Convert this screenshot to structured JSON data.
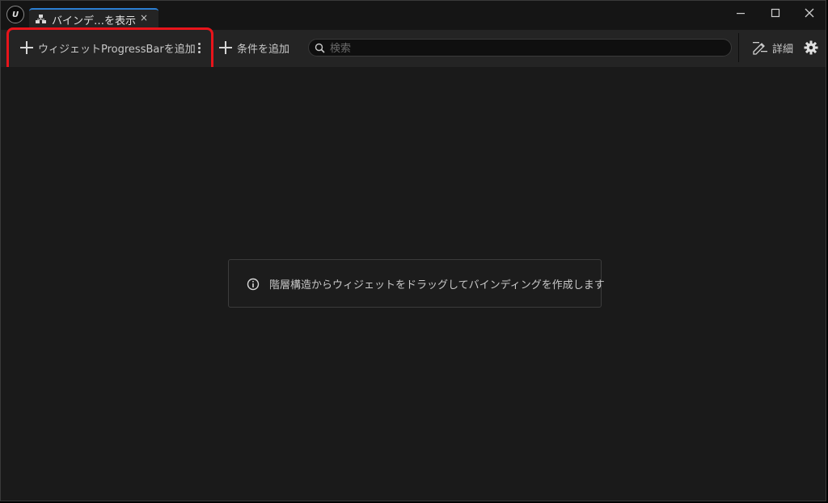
{
  "window": {
    "tab_title": "バインデ…を表示",
    "tab_close": "×"
  },
  "toolbar": {
    "add_widget_label": "ウィジェットProgressBarを追加",
    "add_condition_label": "条件を追加",
    "search_placeholder": "検索",
    "search_value": "",
    "details_label": "詳細"
  },
  "content": {
    "info_message": "階層構造からウィジェットをドラッグしてバインディングを作成します"
  },
  "colors": {
    "highlight": "#e8141b",
    "tab_accent": "#2b7fd3",
    "panel_bg": "#1a1a1a",
    "toolbar_bg": "#242424"
  },
  "icons": {
    "app_logo": "unreal-logo-icon",
    "tab": "hierarchy-icon",
    "minimize": "minimize-icon",
    "maximize": "maximize-icon",
    "close": "close-icon",
    "add": "plus-icon",
    "more": "kebab-menu-icon",
    "search": "search-icon",
    "details": "pencil-edit-icon",
    "settings": "gear-icon",
    "info": "info-icon"
  }
}
